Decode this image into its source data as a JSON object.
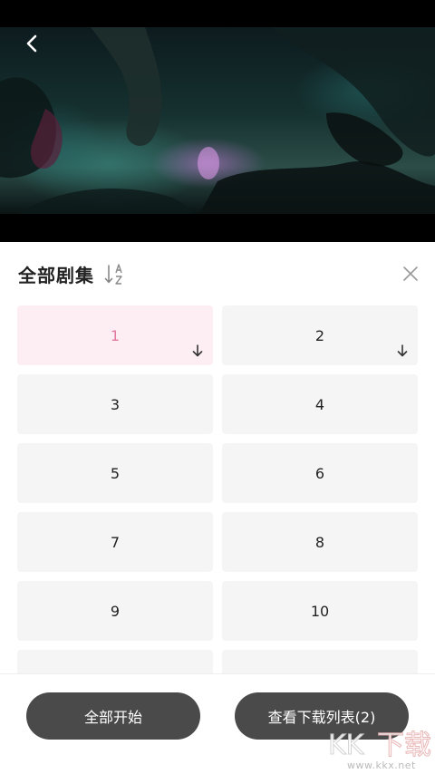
{
  "header": {
    "title": "全部剧集"
  },
  "episodes": [
    {
      "label": "1",
      "downloaded": true,
      "active": true
    },
    {
      "label": "2",
      "downloaded": true,
      "active": false
    },
    {
      "label": "3",
      "downloaded": false,
      "active": false
    },
    {
      "label": "4",
      "downloaded": false,
      "active": false
    },
    {
      "label": "5",
      "downloaded": false,
      "active": false
    },
    {
      "label": "6",
      "downloaded": false,
      "active": false
    },
    {
      "label": "7",
      "downloaded": false,
      "active": false
    },
    {
      "label": "8",
      "downloaded": false,
      "active": false
    },
    {
      "label": "9",
      "downloaded": false,
      "active": false
    },
    {
      "label": "10",
      "downloaded": false,
      "active": false
    },
    {
      "label": "",
      "downloaded": false,
      "active": false
    },
    {
      "label": "",
      "downloaded": false,
      "active": false
    }
  ],
  "actions": {
    "start_all": "全部开始",
    "view_list": "查看下载列表(2)"
  },
  "watermark": {
    "text": "www.kkx.net",
    "logo": "KK下载"
  },
  "colors": {
    "active_bg": "#fdeef4",
    "active_text": "#e07aa0",
    "button_bg": "#4a4a4a"
  },
  "icons": {
    "back": "chevron-left-icon",
    "sort": "sort-az-icon",
    "close": "close-icon",
    "download": "arrow-down-icon"
  }
}
